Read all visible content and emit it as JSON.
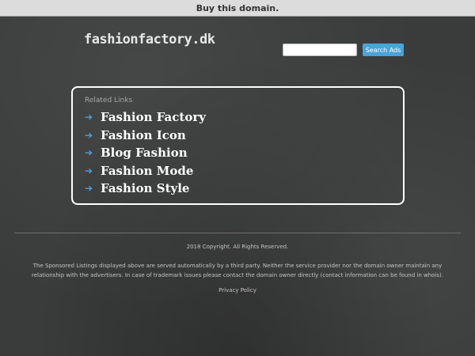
{
  "topbar": {
    "buy_label": "Buy this domain."
  },
  "header": {
    "logo_text": "fashionfactory.dk"
  },
  "search": {
    "placeholder": "",
    "button_label": "Search Ads"
  },
  "related": {
    "heading": "Related Links",
    "arrow_icon": "arrow-right-icon",
    "items": [
      {
        "label": "Fashion Factory"
      },
      {
        "label": "Fashion Icon"
      },
      {
        "label": "Blog Fashion"
      },
      {
        "label": "Fashion Mode"
      },
      {
        "label": "Fashion Style"
      }
    ]
  },
  "footer": {
    "copyright": "2018 Copyright. All Rights Reserved.",
    "disclaimer": "The Sponsored Listings displayed above are served automatically by a third party. Neither the service provider nor the domain owner maintain any relationship with the advertisers. In case of trademark issues please contact the domain owner directly (contact information can be found in whois).",
    "privacy_label": "Privacy Policy"
  },
  "colors": {
    "background": "#3a3b3b",
    "accent": "#4aa3d9",
    "link_text": "#ffffff"
  }
}
